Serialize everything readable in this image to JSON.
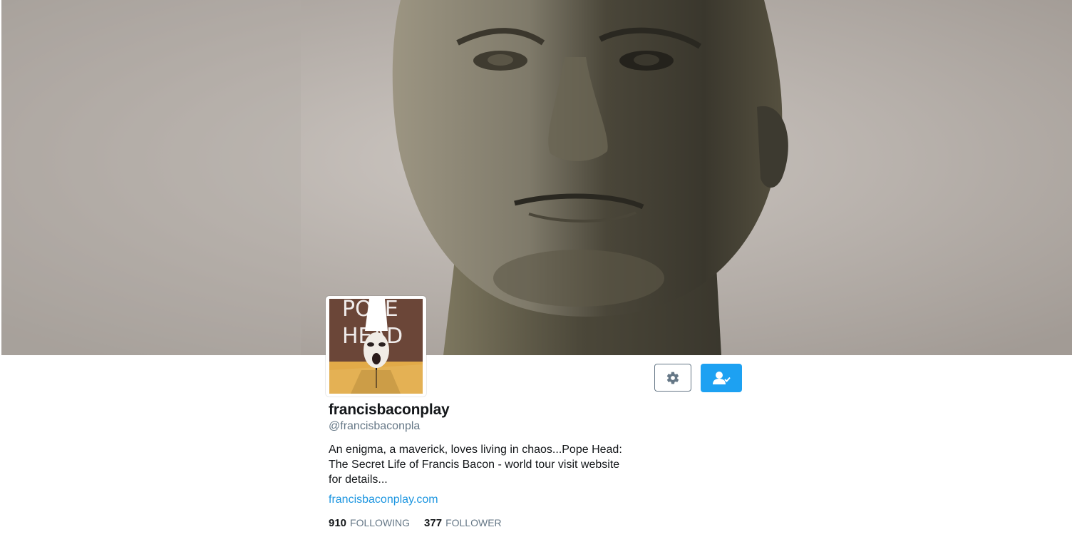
{
  "profile": {
    "display_name": "francisbaconplay",
    "handle": "@francisbaconpla",
    "bio": "An enigma, a maverick, loves living in chaos...Pope Head: The Secret Life of Francis Bacon - world tour visit website for details...",
    "website": "francisbaconplay.com",
    "avatar_text_line1": "POPE",
    "avatar_text_line2": "HEAD"
  },
  "stats": {
    "following_count": "910",
    "following_label": "FOLLOWING",
    "follower_count": "377",
    "follower_label": "FOLLOWER"
  },
  "icons": {
    "settings": "gear-icon",
    "following_state": "user-check-icon"
  },
  "colors": {
    "accent": "#1da1f2",
    "link": "#1b95e0",
    "secondary_text": "#657786",
    "primary_text": "#14171a"
  }
}
